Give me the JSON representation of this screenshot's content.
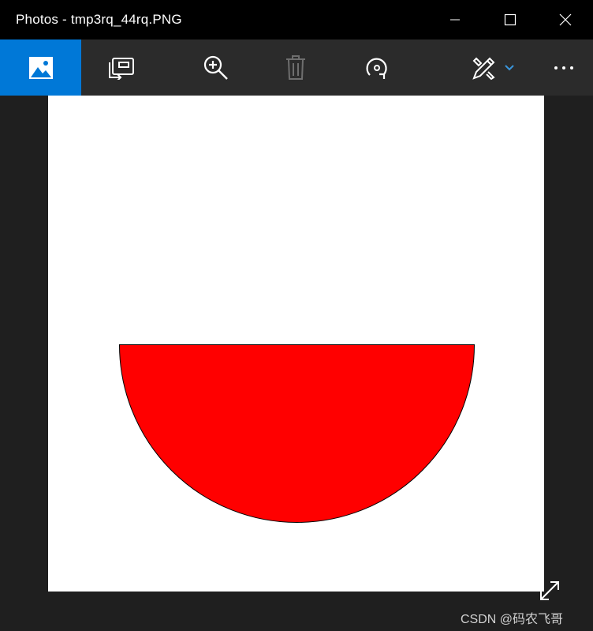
{
  "window": {
    "title": "Photos - tmp3rq_44rq.PNG"
  },
  "colors": {
    "title_bar": "#000000",
    "toolbar": "#2b2b2b",
    "background": "#1f1f1f",
    "accent": "#0078d7",
    "shape_fill": "#ff0000",
    "shape_stroke": "#000000"
  },
  "toolbar": {
    "buttons": [
      {
        "name": "view-photo",
        "icon": "image-icon",
        "active": true
      },
      {
        "name": "slideshow",
        "icon": "slideshow-icon"
      },
      {
        "name": "zoom",
        "icon": "zoom-in-icon"
      },
      {
        "name": "delete",
        "icon": "trash-icon",
        "disabled": true
      },
      {
        "name": "rotate",
        "icon": "rotate-icon"
      },
      {
        "name": "edit-create",
        "icon": "pencil-brush-icon",
        "has_dropdown": true
      },
      {
        "name": "more",
        "icon": "ellipsis-icon"
      }
    ]
  },
  "image": {
    "shape": "semicircle",
    "fill": "#ff0000"
  },
  "watermark": {
    "text": "CSDN @码农飞哥"
  }
}
